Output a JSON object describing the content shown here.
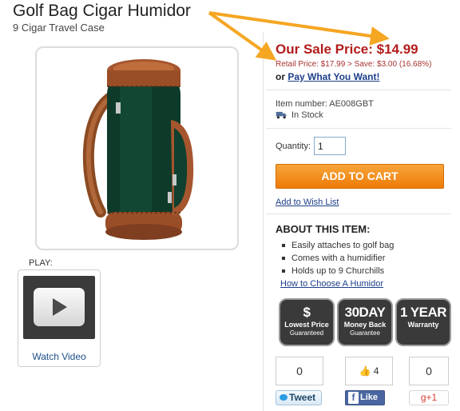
{
  "product": {
    "title": "Golf Bag Cigar Humidor",
    "subtitle": "9 Cigar Travel Case"
  },
  "media": {
    "play_label": "PLAY:",
    "watch_video": "Watch Video"
  },
  "pricing": {
    "sale_price_label": "Our Sale Price: $14.99",
    "retail_line": "Retail Price: $17.99 > Save: $3.00 (16.68%)",
    "pwyw_prefix": "or ",
    "pwyw_link": "Pay What You Want!"
  },
  "info": {
    "item_number": "Item number: AE008GBT",
    "stock": "In Stock"
  },
  "purchase": {
    "quantity_label": "Quantity:",
    "quantity_value": "1",
    "add_to_cart": "ADD TO CART",
    "wishlist": "Add to Wish List"
  },
  "about": {
    "heading": "ABOUT THIS ITEM:",
    "features": [
      "Easily attaches to golf bag",
      "Comes with a humidifier",
      "Holds up to 9 Churchills"
    ],
    "choose_link": "How to Choose A Humidor"
  },
  "badges": [
    {
      "big": "$",
      "line1": "Lowest Price",
      "line2": "Guaranteed"
    },
    {
      "big": "30DAY",
      "line1": "Money Back",
      "line2": "Guarantee"
    },
    {
      "big": "1 YEAR",
      "line1": "Warranty",
      "line2": ""
    }
  ],
  "social": {
    "tweet_count": "0",
    "tweet_label": "Tweet",
    "fb_count": "4",
    "fb_label": "Like",
    "gplus_count": "0",
    "gplus_label": "g+1"
  },
  "colors": {
    "sale_red": "#b31b1b",
    "cart_orange": "#ee7b07",
    "arrow_orange": "#f5a623",
    "link_blue": "#1d3f8a"
  }
}
